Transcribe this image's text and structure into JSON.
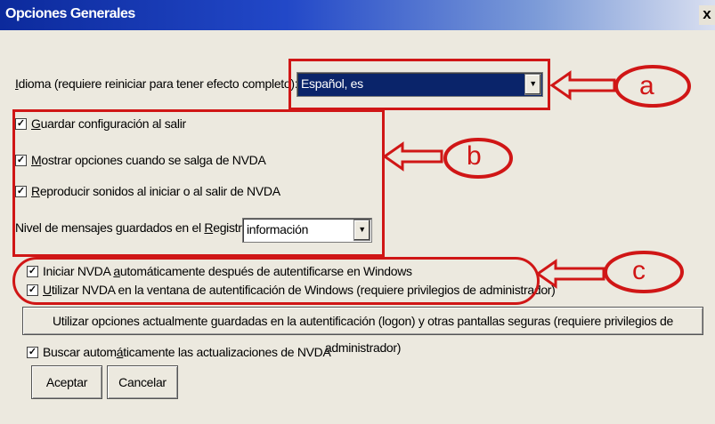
{
  "window": {
    "title": "Opciones Generales",
    "close_glyph": "x"
  },
  "language": {
    "label_prefix": "",
    "label_accel": "I",
    "label_rest": "dioma (requiere reiniciar para tener efecto completo):",
    "value": "Español, es"
  },
  "checkboxes": {
    "save_config": {
      "checked": true,
      "accel": "G",
      "rest": "uardar configuración al salir"
    },
    "show_exit_options": {
      "checked": true,
      "accel": "M",
      "rest": "ostrar opciones cuando se salga de NVDA"
    },
    "play_sounds": {
      "checked": true,
      "accel": "R",
      "rest": "eproducir sonidos al iniciar o al salir de NVDA"
    },
    "autostart_after_logon": {
      "checked": true,
      "pre": "Iniciar NVDA ",
      "accel": "a",
      "rest": "utomáticamente después de autentificarse en Windows"
    },
    "use_on_logon_screen": {
      "checked": true,
      "accel": "U",
      "rest": "tilizar NVDA en la ventana de autentificación de Windows (requiere privilegios de administrador)"
    },
    "check_updates": {
      "checked": true,
      "pre": "Buscar autom",
      "accel": "á",
      "rest": "ticamente las actualizaciones de NVDA"
    }
  },
  "log_level": {
    "label_pre": "Nivel de mensajes guardados en el ",
    "label_accel": "R",
    "label_rest": "egistro",
    "value": "información"
  },
  "buttons": {
    "use_saved_settings": "Utilizar opciones actualmente guardadas en la autentificación (logon) y otras pantallas seguras (requiere privilegios de administrador)",
    "ok": "Aceptar",
    "cancel": "Cancelar"
  },
  "annotations": {
    "a": "a",
    "b": "b",
    "c": "c",
    "color": "#d01616"
  },
  "icons": {
    "dropdown": "triangle-down-icon",
    "check": "checkmark-icon"
  }
}
